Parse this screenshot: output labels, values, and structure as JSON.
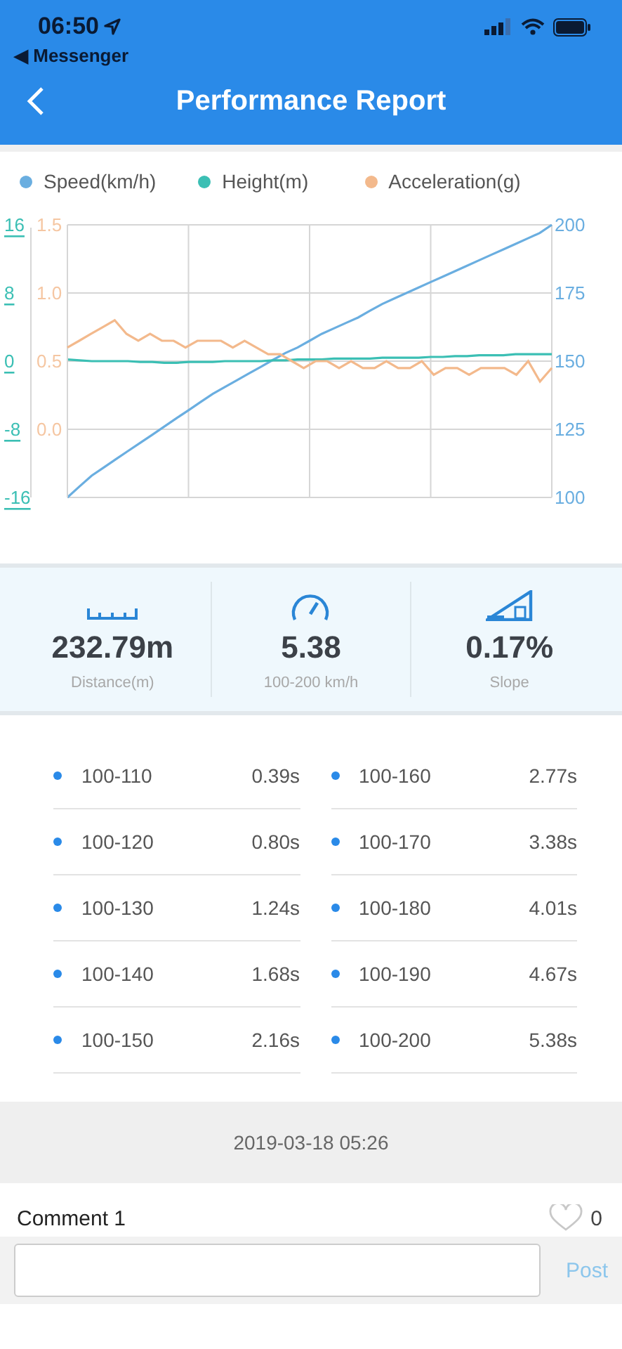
{
  "status_bar": {
    "time": "06:50",
    "back_app": "◀ Messenger"
  },
  "nav": {
    "title": "Performance Report"
  },
  "chart": {
    "layers": [
      {
        "chart_data": {
          "type": "line",
          "grid": true,
          "ylim": [
            100,
            200
          ],
          "yticks": [
            100,
            125,
            150,
            175,
            200
          ],
          "series": [
            {
              "name": "Speed(km/h)",
              "color": "#6aaee0",
              "values": [
                100,
                104,
                108,
                111,
                114,
                117,
                120,
                123,
                126,
                129,
                132,
                135,
                138,
                140.5,
                143,
                145.5,
                148,
                150.5,
                153,
                155,
                157.5,
                160,
                162,
                164,
                166,
                168.5,
                171,
                173,
                175,
                177,
                179,
                181,
                183,
                185,
                187,
                189,
                191,
                193,
                195,
                197,
                200
              ]
            }
          ]
        }
      },
      {
        "chart_data": {
          "type": "line",
          "ylim": [
            -16,
            16
          ],
          "yticks": [
            -16,
            -8,
            0,
            8,
            16
          ],
          "series": [
            {
              "name": "Height(m)",
              "color": "#3bbfb4",
              "values": [
                0.2,
                0.1,
                0,
                0,
                0,
                0,
                -0.1,
                -0.1,
                -0.2,
                -0.2,
                -0.1,
                -0.1,
                -0.1,
                0,
                0,
                0,
                0,
                0.1,
                0.1,
                0.2,
                0.2,
                0.2,
                0.3,
                0.3,
                0.3,
                0.3,
                0.4,
                0.4,
                0.4,
                0.4,
                0.5,
                0.5,
                0.6,
                0.6,
                0.7,
                0.7,
                0.7,
                0.8,
                0.8,
                0.8,
                0.8
              ]
            }
          ]
        }
      },
      {
        "chart_data": {
          "type": "line",
          "ylim": [
            -0.5,
            1.5
          ],
          "yticks": [
            {
              "value": 0,
              "label": "0.0"
            },
            {
              "value": 0.5,
              "label": "0.5"
            },
            {
              "value": 1,
              "label": "1.0"
            },
            {
              "value": 1.5,
              "label": "1.5"
            }
          ],
          "series": [
            {
              "name": "Acceleration(g)",
              "color": "#f3b98c",
              "values": [
                0.6,
                0.65,
                0.7,
                0.75,
                0.8,
                0.7,
                0.65,
                0.7,
                0.65,
                0.65,
                0.6,
                0.65,
                0.65,
                0.65,
                0.6,
                0.65,
                0.6,
                0.55,
                0.55,
                0.5,
                0.45,
                0.5,
                0.5,
                0.45,
                0.5,
                0.45,
                0.45,
                0.5,
                0.45,
                0.45,
                0.5,
                0.4,
                0.45,
                0.45,
                0.4,
                0.45,
                0.45,
                0.45,
                0.4,
                0.5,
                0.35,
                0.45
              ]
            }
          ]
        }
      }
    ]
  },
  "stats": [
    {
      "kind": "distance",
      "value": "232.79m",
      "label": "Distance(m)"
    },
    {
      "kind": "speed",
      "value": "5.38",
      "label": "100-200 km/h"
    },
    {
      "kind": "slope",
      "value": "0.17%",
      "label": "Slope"
    }
  ],
  "splits": [
    {
      "range": "100-110",
      "time": "0.39s"
    },
    {
      "range": "100-120",
      "time": "0.80s"
    },
    {
      "range": "100-130",
      "time": "1.24s"
    },
    {
      "range": "100-140",
      "time": "1.68s"
    },
    {
      "range": "100-150",
      "time": "2.16s"
    },
    {
      "range": "100-160",
      "time": "2.77s"
    },
    {
      "range": "100-170",
      "time": "3.38s"
    },
    {
      "range": "100-180",
      "time": "4.01s"
    },
    {
      "range": "100-190",
      "time": "4.67s"
    },
    {
      "range": "100-200",
      "time": "5.38s"
    }
  ],
  "date": "2019-03-18 05:26",
  "comment": {
    "title": "Comment 1",
    "likes": "0"
  },
  "input": {
    "button": "Post"
  }
}
